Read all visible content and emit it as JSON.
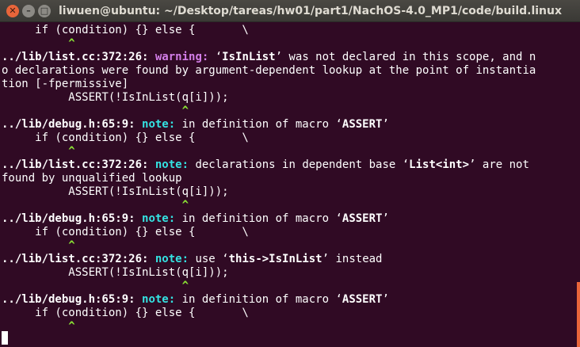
{
  "window": {
    "title": "liwuen@ubuntu: ~/Desktop/tareas/hw01/part1/NachOS-4.0_MP1/code/build.linux",
    "close_glyph": "✕",
    "minimize_glyph": "–",
    "maximize_glyph": "□"
  },
  "terminal": {
    "lines": [
      [
        {
          "t": "     if (condition) {} else {       \\"
        }
      ],
      [
        {
          "t": "          "
        },
        {
          "t": "^",
          "c": "caret"
        }
      ],
      [
        {
          "t": "../lib/list.cc:372:26: ",
          "c": "b"
        },
        {
          "t": "warning: ",
          "c": "warn"
        },
        {
          "t": "‘"
        },
        {
          "t": "IsInList",
          "c": "b"
        },
        {
          "t": "’ was not declared in this scope, and n"
        }
      ],
      [
        {
          "t": "o declarations were found by argument-dependent lookup at the point of instantia"
        }
      ],
      [
        {
          "t": "tion [-fpermissive]"
        }
      ],
      [
        {
          "t": "          ASSERT(!IsInList(q[i]));"
        }
      ],
      [
        {
          "t": "                           "
        },
        {
          "t": "^",
          "c": "caret"
        }
      ],
      [
        {
          "t": "../lib/debug.h:65:9: ",
          "c": "b"
        },
        {
          "t": "note: ",
          "c": "note"
        },
        {
          "t": "in definition of macro ‘"
        },
        {
          "t": "ASSERT",
          "c": "b"
        },
        {
          "t": "’"
        }
      ],
      [
        {
          "t": "     if (condition) {} else {       \\"
        }
      ],
      [
        {
          "t": "          "
        },
        {
          "t": "^",
          "c": "caret"
        }
      ],
      [
        {
          "t": "../lib/list.cc:372:26: ",
          "c": "b"
        },
        {
          "t": "note: ",
          "c": "note"
        },
        {
          "t": "declarations in dependent base ‘"
        },
        {
          "t": "List<int>",
          "c": "b"
        },
        {
          "t": "’ are not"
        }
      ],
      [
        {
          "t": "found by unqualified lookup"
        }
      ],
      [
        {
          "t": "          ASSERT(!IsInList(q[i]));"
        }
      ],
      [
        {
          "t": "                           "
        },
        {
          "t": "^",
          "c": "caret"
        }
      ],
      [
        {
          "t": "../lib/debug.h:65:9: ",
          "c": "b"
        },
        {
          "t": "note: ",
          "c": "note"
        },
        {
          "t": "in definition of macro ‘"
        },
        {
          "t": "ASSERT",
          "c": "b"
        },
        {
          "t": "’"
        }
      ],
      [
        {
          "t": "     if (condition) {} else {       \\"
        }
      ],
      [
        {
          "t": "          "
        },
        {
          "t": "^",
          "c": "caret"
        }
      ],
      [
        {
          "t": "../lib/list.cc:372:26: ",
          "c": "b"
        },
        {
          "t": "note: ",
          "c": "note"
        },
        {
          "t": "use ‘"
        },
        {
          "t": "this->IsInList",
          "c": "b"
        },
        {
          "t": "’ instead"
        }
      ],
      [
        {
          "t": "          ASSERT(!IsInList(q[i]));"
        }
      ],
      [
        {
          "t": "                           "
        },
        {
          "t": "^",
          "c": "caret"
        }
      ],
      [
        {
          "t": "../lib/debug.h:65:9: ",
          "c": "b"
        },
        {
          "t": "note: ",
          "c": "note"
        },
        {
          "t": "in definition of macro ‘"
        },
        {
          "t": "ASSERT",
          "c": "b"
        },
        {
          "t": "’"
        }
      ],
      [
        {
          "t": "     if (condition) {} else {       \\"
        }
      ],
      [
        {
          "t": "          "
        },
        {
          "t": "^",
          "c": "caret"
        }
      ]
    ]
  },
  "colors": {
    "background": "#300a24",
    "warning": "#d37ee8",
    "note": "#34e2e2",
    "caret": "#8ae234",
    "close_button": "#e9653a"
  }
}
